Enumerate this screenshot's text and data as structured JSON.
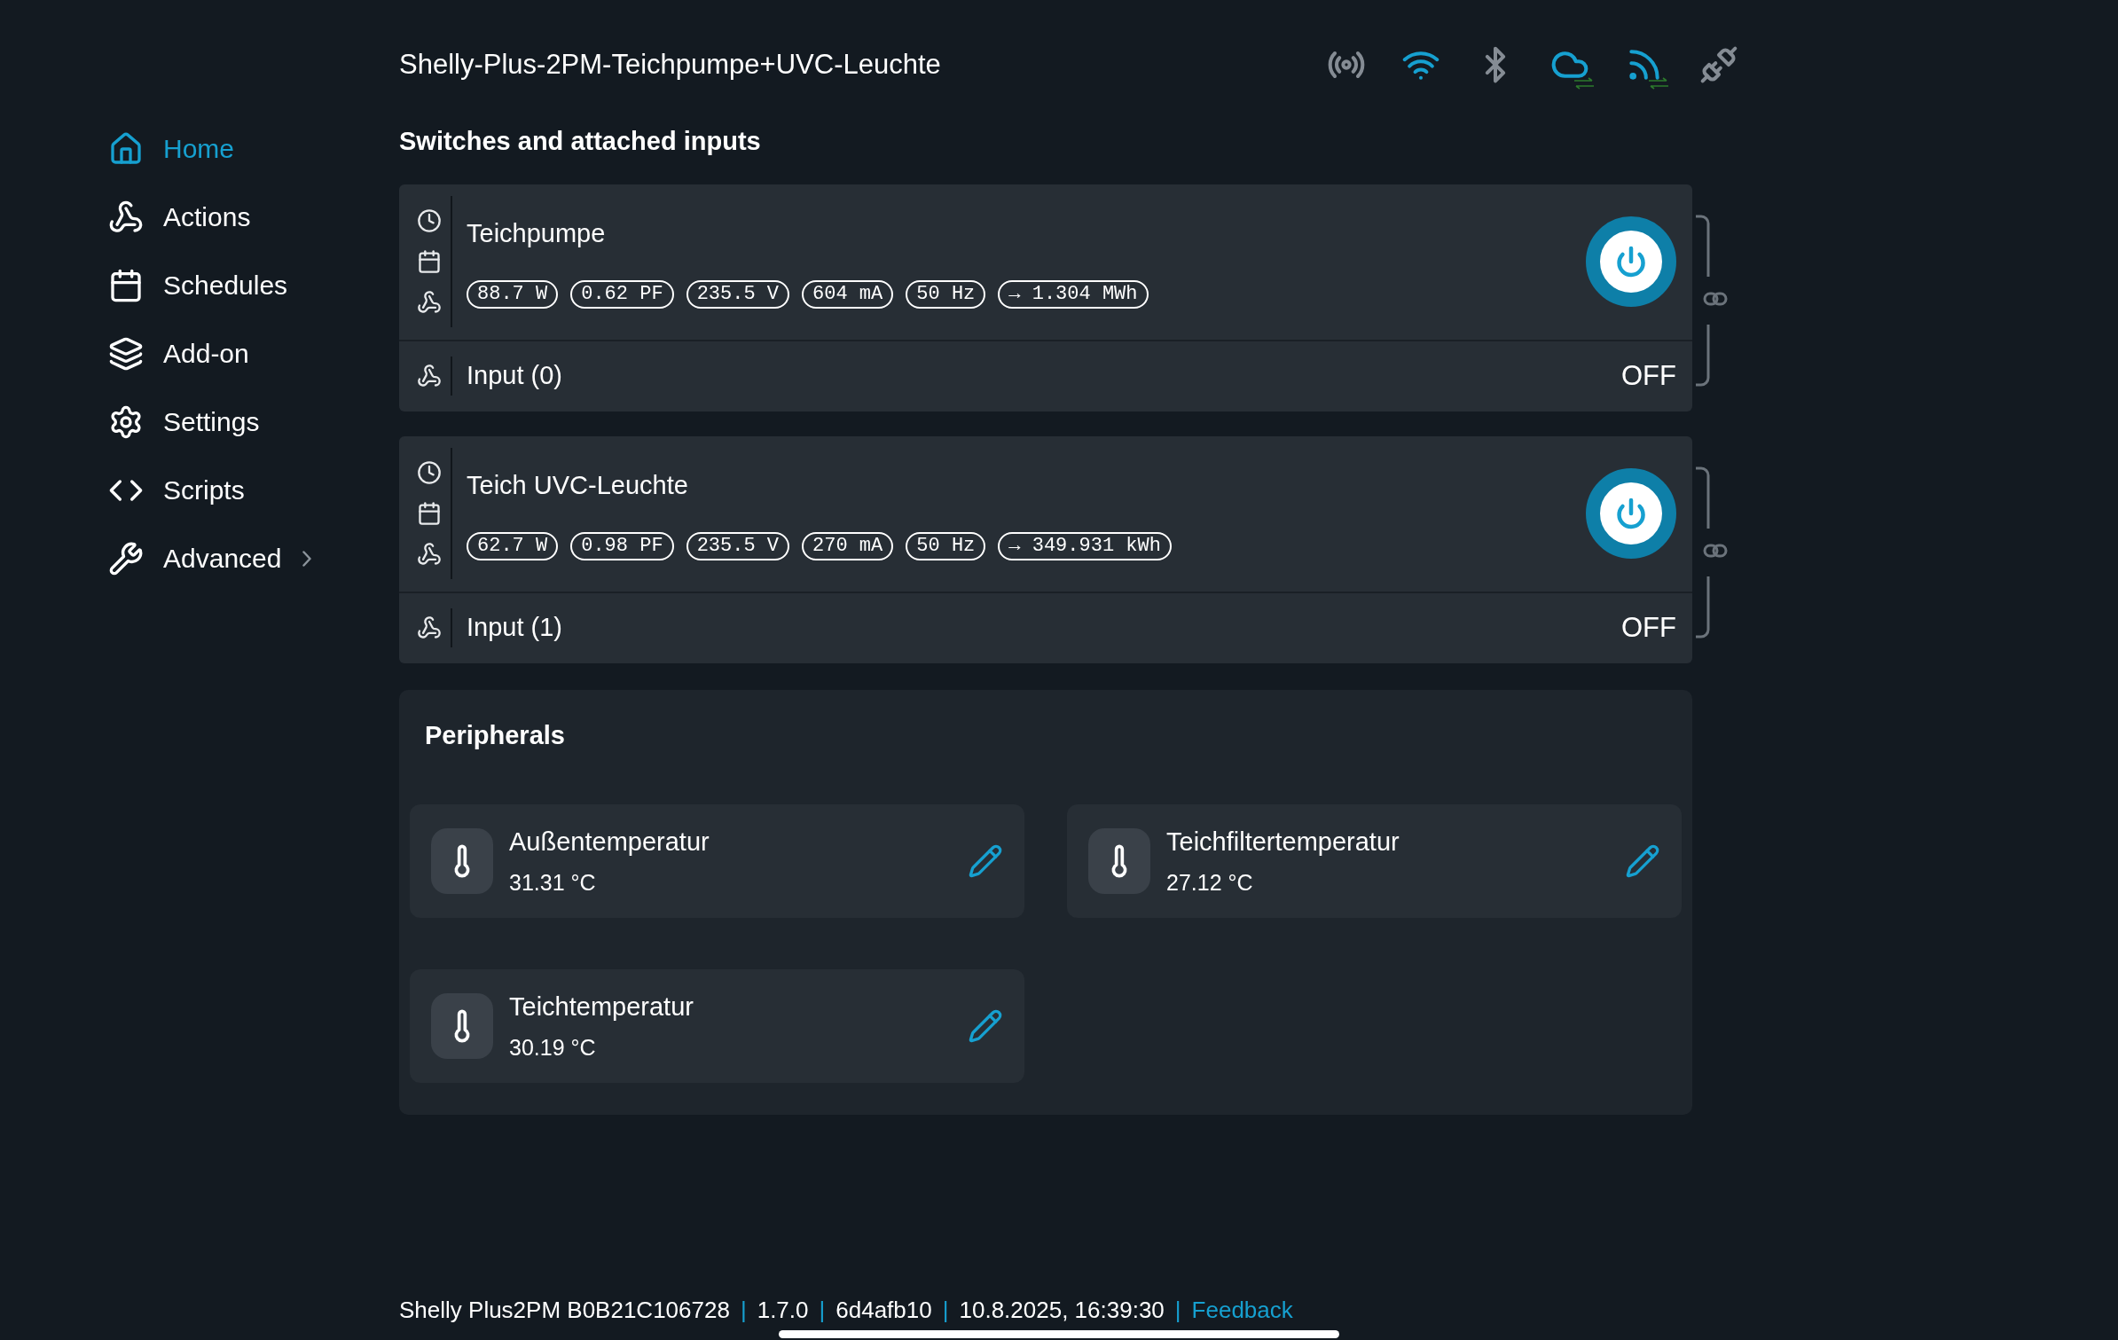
{
  "device_title": "Shelly-Plus-2PM-Teichpumpe+UVC-Leuchte",
  "status_icons": [
    {
      "kind": "ap",
      "active": false
    },
    {
      "kind": "wifi",
      "active": true
    },
    {
      "kind": "bluetooth",
      "active": false
    },
    {
      "kind": "cloud",
      "active": true
    },
    {
      "kind": "mqtt",
      "active": true
    },
    {
      "kind": "websocket",
      "active": false
    }
  ],
  "sidebar": {
    "items": [
      {
        "label": "Home",
        "selected": true,
        "has_submenu": false
      },
      {
        "label": "Actions",
        "selected": false,
        "has_submenu": false
      },
      {
        "label": "Schedules",
        "selected": false,
        "has_submenu": false
      },
      {
        "label": "Add-on",
        "selected": false,
        "has_submenu": false
      },
      {
        "label": "Settings",
        "selected": false,
        "has_submenu": false
      },
      {
        "label": "Scripts",
        "selected": false,
        "has_submenu": false
      },
      {
        "label": "Advanced",
        "selected": false,
        "has_submenu": true
      }
    ]
  },
  "switches": {
    "heading": "Switches and attached inputs",
    "items": [
      {
        "name": "Teichpumpe",
        "on": true,
        "readings": [
          "88.7 W",
          "0.62 PF",
          "235.5 V",
          "604 mA",
          "50 Hz",
          "→ 1.304 MWh"
        ],
        "input": {
          "label": "Input (0)",
          "state": "OFF"
        }
      },
      {
        "name": "Teich UVC-Leuchte",
        "on": true,
        "readings": [
          "62.7 W",
          "0.98 PF",
          "235.5 V",
          "270 mA",
          "50 Hz",
          "→ 349.931 kWh"
        ],
        "input": {
          "label": "Input (1)",
          "state": "OFF"
        }
      }
    ]
  },
  "peripherals": {
    "title": "Peripherals",
    "items": [
      {
        "name": "Außentemperatur",
        "value": "31.31 °C"
      },
      {
        "name": "Teichfiltertemperatur",
        "value": "27.12 °C"
      },
      {
        "name": "Teichtemperatur",
        "value": "30.19 °C"
      }
    ]
  },
  "footer": {
    "parts": [
      {
        "kind": "text",
        "text": "Shelly Plus2PM B0B21C106728"
      },
      {
        "kind": "separator",
        "text": "|"
      },
      {
        "kind": "text",
        "text": "1.7.0"
      },
      {
        "kind": "separator",
        "text": "|"
      },
      {
        "kind": "text",
        "text": "6d4afb10"
      },
      {
        "kind": "separator",
        "text": "|"
      },
      {
        "kind": "text",
        "text": "10.8.2025, 16:39:30"
      },
      {
        "kind": "separator",
        "text": "|"
      },
      {
        "kind": "link",
        "text": "Feedback"
      }
    ]
  }
}
